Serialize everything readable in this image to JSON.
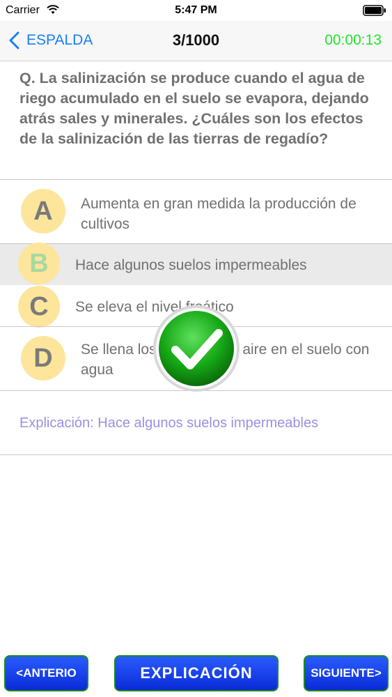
{
  "status_bar": {
    "carrier": "Carrier",
    "time": "5:47 PM"
  },
  "nav": {
    "back_label": "ESPALDA",
    "title": "3/1000",
    "timer": "00:00:13",
    "timer_color": "#1ee62a",
    "accent_color": "#1a7ef7"
  },
  "question": "Q. La salinización se produce cuando el agua de riego acumulado en el suelo se evapora, dejando atrás sales y minerales. ¿Cuáles son los efectos de la salinización de las tierras de regadío?",
  "options": [
    {
      "letter": "A",
      "text": "Aumenta en gran medida la producción de cultivos"
    },
    {
      "letter": "B",
      "text": "Hace algunos suelos impermeables",
      "selected": true
    },
    {
      "letter": "C",
      "text": "Se eleva el nivel freático"
    },
    {
      "letter": "D",
      "text": "Se llena los espacios de aire en el suelo con agua"
    }
  ],
  "result_icon": "checkmark-icon",
  "explanation": "Explicación: Hace algunos suelos impermeables",
  "buttons": {
    "prev": "<ANTERIO",
    "explain": "EXPLICACIÓN",
    "next": "SIGUIENTE>"
  }
}
